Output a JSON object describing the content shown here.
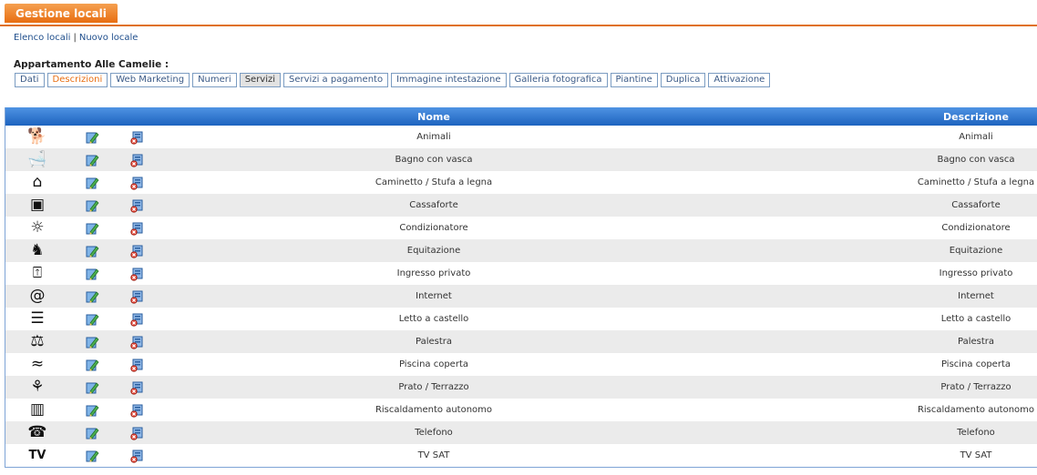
{
  "header": {
    "section_title": "Gestione locali"
  },
  "links": {
    "list": "Elenco locali",
    "separator": "|",
    "new": "Nuovo locale"
  },
  "property": {
    "title": "Appartamento Alle Camelie :"
  },
  "tabs": [
    {
      "label": "Dati",
      "state": "normal"
    },
    {
      "label": "Descrizioni",
      "state": "active"
    },
    {
      "label": "Web Marketing",
      "state": "normal"
    },
    {
      "label": "Numeri",
      "state": "normal"
    },
    {
      "label": "Servizi",
      "state": "selected"
    },
    {
      "label": "Servizi a pagamento",
      "state": "normal"
    },
    {
      "label": "Immagine intestazione",
      "state": "normal"
    },
    {
      "label": "Galleria fotografica",
      "state": "normal"
    },
    {
      "label": "Piantine",
      "state": "normal"
    },
    {
      "label": "Duplica",
      "state": "normal"
    },
    {
      "label": "Attivazione",
      "state": "normal"
    }
  ],
  "grid": {
    "columns": {
      "nome": "Nome",
      "descrizione": "Descrizione"
    },
    "rows": [
      {
        "icon": "pet-icon",
        "glyph": "🐕",
        "nome": "Animali",
        "descrizione": "Animali"
      },
      {
        "icon": "bathtub-icon",
        "glyph": "🛁",
        "nome": "Bagno con vasca",
        "descrizione": "Bagno con vasca"
      },
      {
        "icon": "fireplace-icon",
        "glyph": "⌂",
        "nome": "Caminetto / Stufa a legna",
        "descrizione": "Caminetto / Stufa a legna"
      },
      {
        "icon": "safe-icon",
        "glyph": "▣",
        "nome": "Cassaforte",
        "descrizione": "Cassaforte"
      },
      {
        "icon": "air-conditioner-icon",
        "glyph": "☼",
        "nome": "Condizionatore",
        "descrizione": "Condizionatore"
      },
      {
        "icon": "horse-icon",
        "glyph": "♞",
        "nome": "Equitazione",
        "descrizione": "Equitazione"
      },
      {
        "icon": "private-entrance-icon",
        "glyph": "⍐",
        "nome": "Ingresso privato",
        "descrizione": "Ingresso privato"
      },
      {
        "icon": "internet-at-icon",
        "glyph": "@",
        "nome": "Internet",
        "descrizione": "Internet"
      },
      {
        "icon": "bunk-bed-icon",
        "glyph": "☰",
        "nome": "Letto a castello",
        "descrizione": "Letto a castello"
      },
      {
        "icon": "gym-icon",
        "glyph": "⚖",
        "nome": "Palestra",
        "descrizione": "Palestra"
      },
      {
        "icon": "indoor-pool-icon",
        "glyph": "≈",
        "nome": "Piscina coperta",
        "descrizione": "Piscina coperta"
      },
      {
        "icon": "terrace-icon",
        "glyph": "⚘",
        "nome": "Prato / Terrazzo",
        "descrizione": "Prato / Terrazzo"
      },
      {
        "icon": "radiator-icon",
        "glyph": "▥",
        "nome": "Riscaldamento autonomo",
        "descrizione": "Riscaldamento autonomo"
      },
      {
        "icon": "telephone-icon",
        "glyph": "☎",
        "nome": "Telefono",
        "descrizione": "Telefono"
      },
      {
        "icon": "tv-sat-icon",
        "glyph": "TV",
        "nome": "TV SAT",
        "descrizione": "TV SAT"
      }
    ]
  },
  "colors": {
    "accent": "#e86e12",
    "grid_header": "#1d63bf",
    "link": "#1f4e8c"
  }
}
